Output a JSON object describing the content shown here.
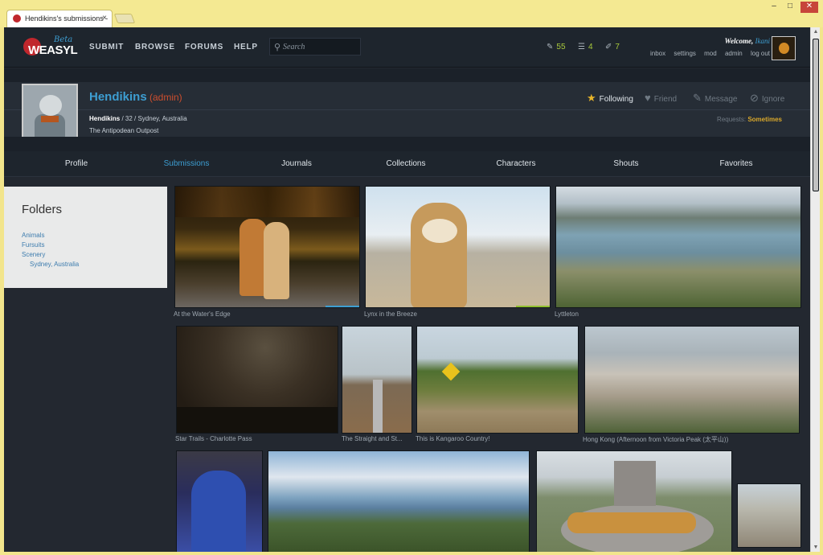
{
  "browser": {
    "tab_title": "Hendikins's submissions -",
    "tab_close": "×",
    "win_min": "–",
    "win_max": "□",
    "win_close": "✕"
  },
  "header": {
    "logo_text": "WEASYL",
    "logo_badge": "Beta",
    "nav": [
      "Submit",
      "Browse",
      "Forums",
      "Help"
    ],
    "search_placeholder": "Search",
    "counts": {
      "submissions": "55",
      "notifications": "4",
      "journals": "7"
    },
    "welcome_prefix": "Welcome,",
    "username": "Ikani",
    "user_links": [
      "inbox",
      "settings",
      "mod",
      "admin",
      "log out"
    ]
  },
  "profile": {
    "name": "Hendikins",
    "role": "(admin)",
    "details_name": "Hendikins",
    "details_rest": " / 32 / Sydney, Australia",
    "subtitle": "The Antipodean Outpost",
    "actions": [
      "Following",
      "Friend",
      "Message",
      "Ignore"
    ],
    "requests_label": "Requests:",
    "requests_value": "Sometimes"
  },
  "tabs": [
    "Profile",
    "Submissions",
    "Journals",
    "Collections",
    "Characters",
    "Shouts",
    "Favorites"
  ],
  "active_tab": "Submissions",
  "folders": {
    "title": "Folders",
    "items": [
      "Animals",
      "Fursuits",
      "Scenery",
      "Sydney, Australia"
    ]
  },
  "gallery": [
    {
      "caption": "At the Water's Edge"
    },
    {
      "caption": "Lynx in the Breeze"
    },
    {
      "caption": "Lyttleton"
    },
    {
      "caption": "Star Trails - Charlotte Pass"
    },
    {
      "caption": "The Straight and St..."
    },
    {
      "caption": "This is Kangaroo Country!"
    },
    {
      "caption": "Hong Kong (Afternoon from Victoria Peak (太平山))"
    },
    {
      "caption": ""
    },
    {
      "caption": ""
    },
    {
      "caption": ""
    },
    {
      "caption": ""
    }
  ],
  "colors": {
    "accent": "#3d9ed2",
    "admin": "#cc4e2e",
    "counter": "#a9c93c",
    "requests": "#d9a82b"
  }
}
